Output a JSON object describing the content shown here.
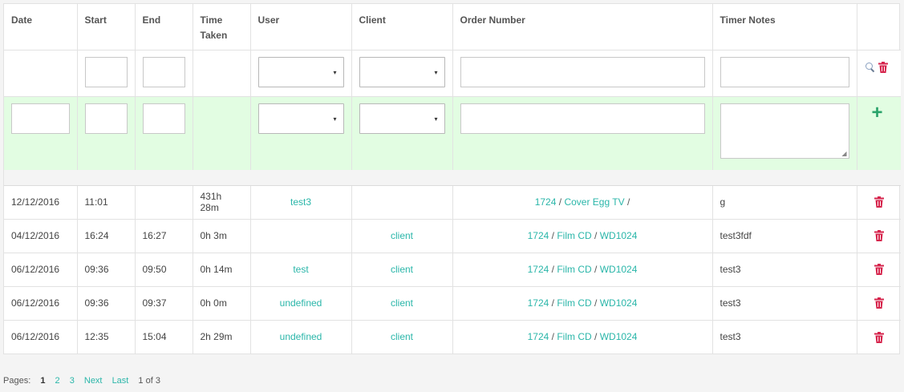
{
  "columns": [
    "Date",
    "Start",
    "End",
    "Time Taken",
    "User",
    "Client",
    "Order Number",
    "Timer Notes"
  ],
  "rows": [
    {
      "date": "12/12/2016",
      "start": "11:01",
      "end": "",
      "time": "431h 28m",
      "user": "test3",
      "client": "",
      "order_parts": [
        "1724",
        "Cover Egg TV",
        ""
      ],
      "notes": "g"
    },
    {
      "date": "04/12/2016",
      "start": "16:24",
      "end": "16:27",
      "time": "0h 3m",
      "user": "",
      "client": "client",
      "order_parts": [
        "1724",
        "Film CD",
        "WD1024"
      ],
      "notes": "test3fdf"
    },
    {
      "date": "06/12/2016",
      "start": "09:36",
      "end": "09:50",
      "time": "0h 14m",
      "user": "test",
      "client": "client",
      "order_parts": [
        "1724",
        "Film CD",
        "WD1024"
      ],
      "notes": "test3"
    },
    {
      "date": "06/12/2016",
      "start": "09:36",
      "end": "09:37",
      "time": "0h 0m",
      "user": "undefined",
      "client": "client",
      "order_parts": [
        "1724",
        "Film CD",
        "WD1024"
      ],
      "notes": "test3"
    },
    {
      "date": "06/12/2016",
      "start": "12:35",
      "end": "15:04",
      "time": "2h 29m",
      "user": "undefined",
      "client": "client",
      "order_parts": [
        "1724",
        "Film CD",
        "WD1024"
      ],
      "notes": "test3"
    }
  ],
  "order_separator": "/",
  "add_icon": "+",
  "select_arrow": "▾",
  "pager": {
    "label": "Pages:",
    "pages": [
      "1",
      "2",
      "3"
    ],
    "current": "1",
    "next": "Next",
    "last": "Last",
    "summary": "1 of 3"
  },
  "colors": {
    "link": "#2ab6a9",
    "add_row_bg": "#e2fde2",
    "trash": "#d6244c",
    "add": "#2aa36a"
  }
}
